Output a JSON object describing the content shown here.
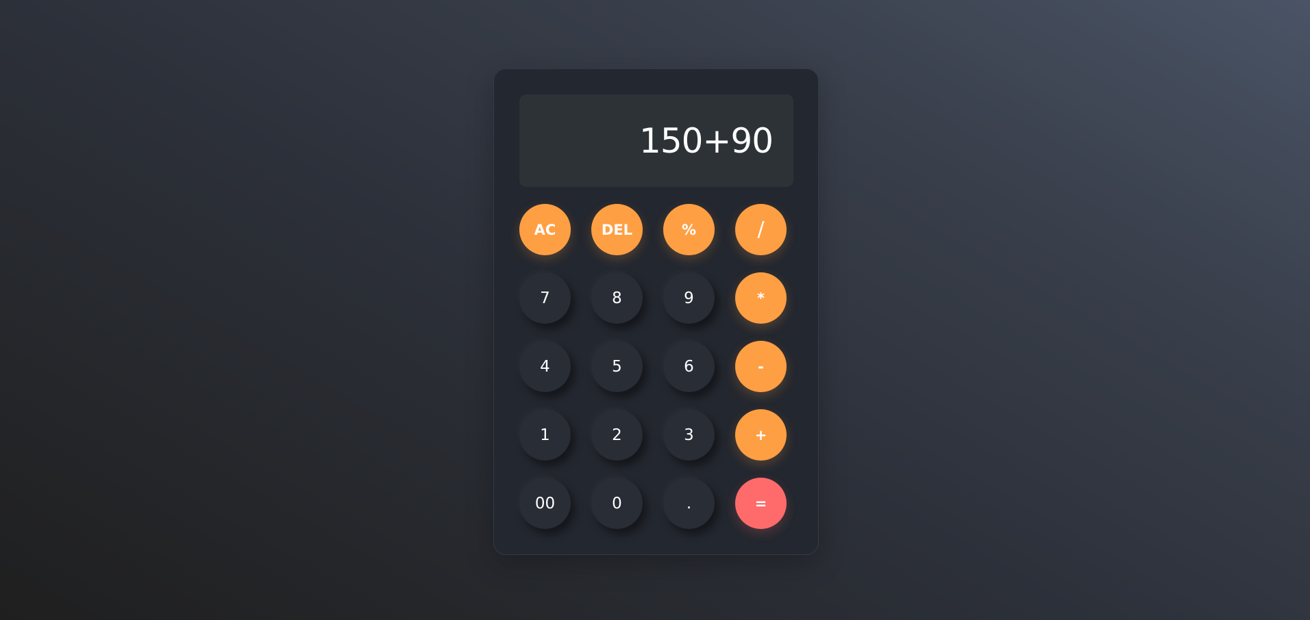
{
  "display": {
    "value": "150+90"
  },
  "keys": [
    {
      "label": "AC",
      "kind": "op",
      "name": "clear-button"
    },
    {
      "label": "DEL",
      "kind": "op",
      "name": "delete-button"
    },
    {
      "label": "%",
      "kind": "op",
      "name": "percent-button"
    },
    {
      "label": "/",
      "kind": "op-big",
      "name": "divide-button"
    },
    {
      "label": "7",
      "kind": "num",
      "name": "digit-7-button"
    },
    {
      "label": "8",
      "kind": "num",
      "name": "digit-8-button"
    },
    {
      "label": "9",
      "kind": "num",
      "name": "digit-9-button"
    },
    {
      "label": "*",
      "kind": "op",
      "name": "multiply-button"
    },
    {
      "label": "4",
      "kind": "num",
      "name": "digit-4-button"
    },
    {
      "label": "5",
      "kind": "num",
      "name": "digit-5-button"
    },
    {
      "label": "6",
      "kind": "num",
      "name": "digit-6-button"
    },
    {
      "label": "-",
      "kind": "op",
      "name": "subtract-button"
    },
    {
      "label": "1",
      "kind": "num",
      "name": "digit-1-button"
    },
    {
      "label": "2",
      "kind": "num",
      "name": "digit-2-button"
    },
    {
      "label": "3",
      "kind": "num",
      "name": "digit-3-button"
    },
    {
      "label": "+",
      "kind": "op",
      "name": "add-button"
    },
    {
      "label": "00",
      "kind": "num",
      "name": "double-zero-button"
    },
    {
      "label": "0",
      "kind": "num",
      "name": "digit-0-button"
    },
    {
      "label": ".",
      "kind": "num",
      "name": "decimal-button"
    },
    {
      "label": "=",
      "kind": "eq",
      "name": "equals-button"
    }
  ],
  "colors": {
    "operator": "#ff9f43",
    "equals": "#ff6b6b",
    "number_key": "#282d36",
    "panel": "#23272f",
    "display": "#2d3236"
  }
}
